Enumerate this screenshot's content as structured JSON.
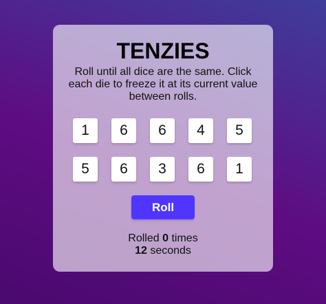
{
  "app": {
    "title": "TENZIES",
    "instructions": "Roll until all dice are the same. Click each die to freeze it at its current value between rolls."
  },
  "dice": [
    {
      "value": "1",
      "held": false
    },
    {
      "value": "6",
      "held": false
    },
    {
      "value": "6",
      "held": false
    },
    {
      "value": "4",
      "held": false
    },
    {
      "value": "5",
      "held": false
    },
    {
      "value": "5",
      "held": false
    },
    {
      "value": "6",
      "held": false
    },
    {
      "value": "3",
      "held": false
    },
    {
      "value": "6",
      "held": false
    },
    {
      "value": "1",
      "held": false
    }
  ],
  "controls": {
    "roll_label": "Roll"
  },
  "stats": {
    "rolled_prefix": "Rolled",
    "roll_count": "0",
    "rolled_suffix": "times",
    "seconds": "12",
    "seconds_suffix": "seconds"
  },
  "colors": {
    "accent": "#5035ff",
    "die_held": "#59E391"
  }
}
